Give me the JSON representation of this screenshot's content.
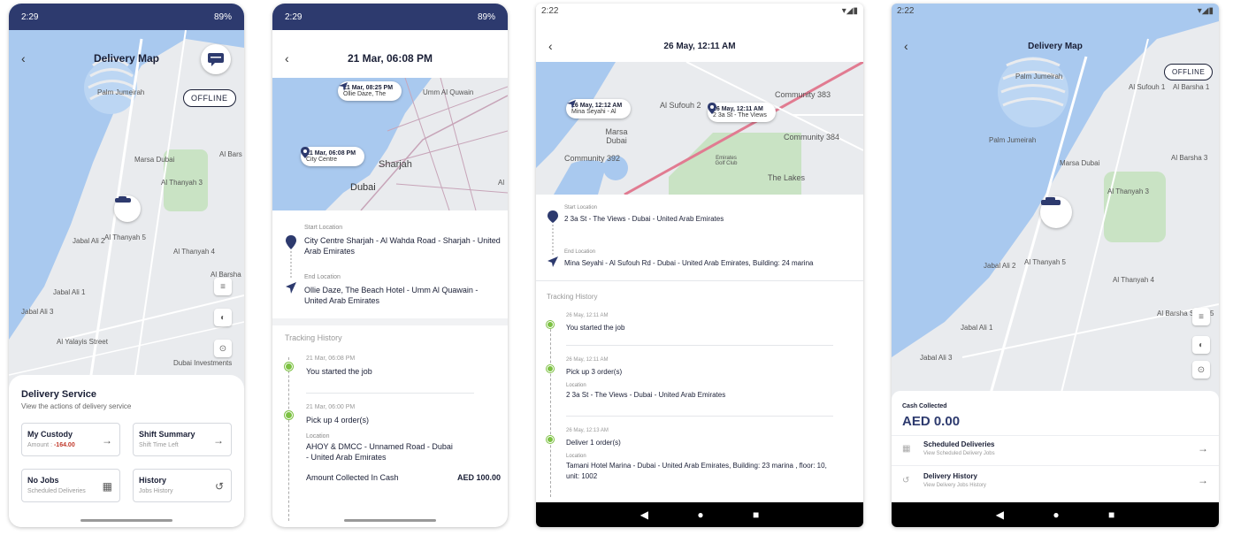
{
  "phone1": {
    "status": {
      "time": "2:29",
      "battery": "89%"
    },
    "title": "Delivery Map",
    "offline": "OFFLINE",
    "map_labels": [
      "Palm Jumeirah",
      "Marsa Dubai",
      "Al Thanyah 3",
      "Jabal Ali 2",
      "Al Thanyah 5",
      "Al Thanyah 4",
      "Jabal Ali 1",
      "Al Barsha",
      "Jabal Ali 3",
      "Al Yalayis Street",
      "Dubai Investments",
      "Al Bars"
    ],
    "sheet_title": "Delivery Service",
    "sheet_sub": "View the actions of delivery service",
    "cards": [
      {
        "title": "My Custody",
        "sub_label": "Amount : ",
        "sub_value": "-164.00"
      },
      {
        "title": "Shift Summary",
        "sub": "Shift Time Left"
      },
      {
        "title": "No Jobs",
        "sub": "Scheduled Deliveries"
      },
      {
        "title": "History",
        "sub": "Jobs History"
      }
    ]
  },
  "phone2": {
    "status": {
      "time": "2:29",
      "battery": "89%"
    },
    "title": "21 Mar, 06:08 PM",
    "tip_end": {
      "time": "21 Mar, 08:25 PM",
      "place": "Ollie Daze, The"
    },
    "tip_start": {
      "time": "21 Mar, 06:08 PM",
      "place": "City Centre"
    },
    "map_labels": [
      "Umm Al Quwain",
      "Sharjah",
      "Dubai",
      "Al"
    ],
    "start_label": "Start Location",
    "start_value": "City Centre Sharjah - Al Wahda Road - Sharjah - United Arab Emirates",
    "end_label": "End Location",
    "end_value": "Ollie Daze, The Beach Hotel - Umm Al Quawain - United Arab Emirates",
    "tracking_title": "Tracking History",
    "events": [
      {
        "date": "21 Mar, 06:08 PM",
        "text": "You started the job"
      },
      {
        "date": "21 Mar, 06:00 PM",
        "text": "Pick up 4 order(s)",
        "loc_label": "Location",
        "loc": "AHOY & DMCC - Unnamed Road - Dubai - United Arab Emirates",
        "cash_label": "Amount Collected In Cash",
        "cash": "AED 100.00"
      }
    ]
  },
  "phone3": {
    "status": {
      "time": "2:22"
    },
    "title": "26 May, 12:11 AM",
    "tip_end": {
      "time": "26 May, 12:12 AM",
      "place": "Mina Seyahi - Al"
    },
    "tip_start": {
      "time": "26 May, 12:11 AM",
      "place": "2 3a St - The Views"
    },
    "map_labels": [
      "Community 383",
      "Al Sufouh 2",
      "Marsa Dubai",
      "Community 384",
      "Community 392",
      "Emirates Golf Club",
      "The Lakes"
    ],
    "start_label": "Start Location",
    "start_value": "2 3a St - The Views - Dubai - United Arab Emirates",
    "end_label": "End Location",
    "end_value": "Mina Seyahi - Al Sufouh Rd - Dubai - United Arab Emirates, Building: 24 marina",
    "tracking_title": "Tracking History",
    "events": [
      {
        "date": "26 May, 12:11 AM",
        "text": "You started the job"
      },
      {
        "date": "26 May, 12:11 AM",
        "text": "Pick up 3 order(s)",
        "loc_label": "Location",
        "loc": "2 3a St - The Views - Dubai - United Arab Emirates"
      },
      {
        "date": "26 May, 12:13 AM",
        "text": "Deliver 1 order(s)",
        "loc_label": "Location",
        "loc": "Tamani Hotel Marina - Dubai - United Arab Emirates, Building: 23 marina , floor: 10, unit: 1002"
      }
    ]
  },
  "phone4": {
    "status": {
      "time": "2:22"
    },
    "title": "Delivery Map",
    "offline": "OFFLINE",
    "map_labels": [
      "Palm Jumeirah",
      "Al Sufouh 1",
      "Al Barsha 1",
      "Palm Jumeirah",
      "Marsa Dubai",
      "Al Barsha 3",
      "Al Thanyah 3",
      "Jabal Ali 2",
      "Al Thanyah 5",
      "Al Thanyah 4",
      "Al Barsha South 5",
      "Jabal Ali 1",
      "Jabal Ali 3"
    ],
    "cash_label": "Cash Collected",
    "cash_value": "AED 0.00",
    "rows": [
      {
        "title": "Scheduled Deliveries",
        "sub": "View Scheduled Delivery Jobs"
      },
      {
        "title": "Delivery History",
        "sub": "View Delivery Jobs History"
      }
    ]
  },
  "colors": {
    "navy": "#2d3a6e",
    "green": "#7cc142",
    "negative": "#c0392b",
    "water": "#a8c8ef",
    "land": "#e8eaed"
  }
}
